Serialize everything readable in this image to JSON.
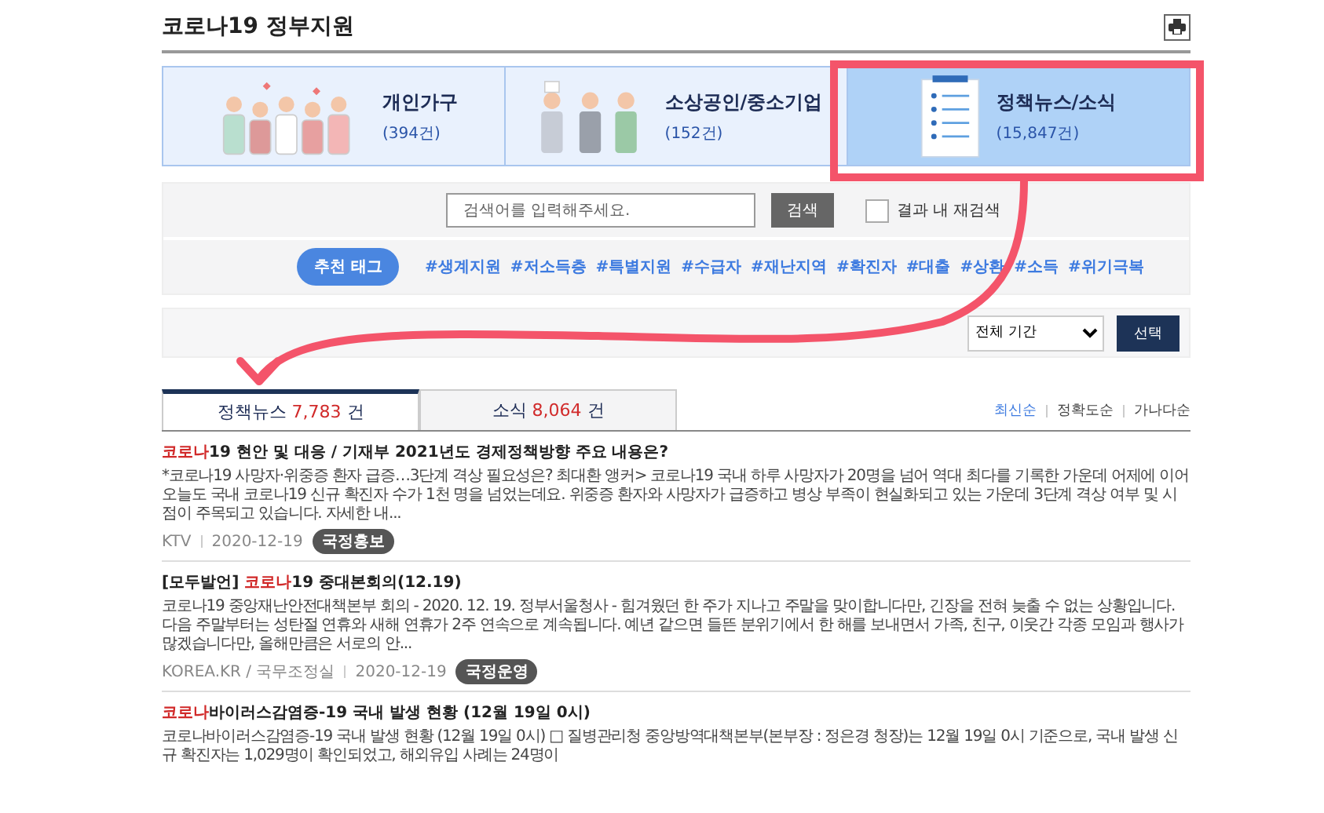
{
  "page_title": "코로나19 정부지원",
  "categories": [
    {
      "kind": "people",
      "label": "개인가구",
      "count": "(394건)",
      "selected": false
    },
    {
      "kind": "workers",
      "label": "소상공인/중소기업",
      "count": "(152건)",
      "selected": false
    },
    {
      "kind": "clipboard",
      "label": "정책뉴스/소식",
      "count": "(15,847건)",
      "selected": true
    }
  ],
  "search": {
    "placeholder": "검색어를 입력해주세요.",
    "button": "검색",
    "refine_label": "결과 내 재검색",
    "refine_checked": false
  },
  "tags": {
    "label": "추천 태그",
    "items": [
      "#생계지원",
      "#저소득층",
      "#특별지원",
      "#수급자",
      "#재난지역",
      "#확진자",
      "#대출",
      "#상환",
      "#소득",
      "#위기극복"
    ]
  },
  "filter": {
    "period": "전체 기간",
    "button": "선택"
  },
  "tabs": [
    {
      "label": "정책뉴스",
      "count": "7,783",
      "unit": "건",
      "selected": true
    },
    {
      "label": "소식",
      "count": "8,064",
      "unit": "건",
      "selected": false
    }
  ],
  "sort": [
    {
      "label": "최신순",
      "selected": true
    },
    {
      "label": "정확도순",
      "selected": false
    },
    {
      "label": "가나다순",
      "selected": false
    }
  ],
  "articles": [
    {
      "title": [
        {
          "kind": "highlight",
          "text": "코로나"
        },
        {
          "kind": "plain",
          "text": "19 현안 및 대응 / 기재부 2021년도 경제정책방향 주요 내용은?"
        }
      ],
      "body": "*코로나19 사망자·위중증 환자 급증…3단계 격상 필요성은? 최대환 앵커> 코로나19 국내 하루 사망자가 20명을 넘어 역대 최다를 기록한 가운데 어제에 이어 오늘도 국내 코로나19 신규 확진자 수가 1천 명을 넘었는데요. 위중증 환자와 사망자가 급증하고 병상 부족이 현실화되고 있는 가운데 3단계 격상 여부 및 시점이 주목되고 있습니다. 자세한 내...",
      "source": "KTV",
      "date": "2020-12-19",
      "badge": "국정홍보"
    },
    {
      "title": [
        {
          "kind": "plain",
          "text": "[모두발언] "
        },
        {
          "kind": "highlight",
          "text": "코로나"
        },
        {
          "kind": "plain",
          "text": "19 중대본회의(12.19)"
        }
      ],
      "body": "코로나19 중앙재난안전대책본부 회의 - 2020. 12. 19. 정부서울청사 - 힘겨웠던 한 주가 지나고 주말을 맞이합니다만, 긴장을 전혀 늦출 수 없는 상황입니다. 다음 주말부터는 성탄절 연휴와 새해 연휴가 2주 연속으로 계속됩니다. 예년 같으면 들뜬 분위기에서 한 해를 보내면서 가족, 친구, 이웃간 각종 모임과 행사가 많겠습니다만, 올해만큼은 서로의 안...",
      "source": "KOREA.KR / 국무조정실",
      "date": "2020-12-19",
      "badge": "국정운영"
    },
    {
      "title": [
        {
          "kind": "highlight",
          "text": "코로나"
        },
        {
          "kind": "plain",
          "text": "바이러스감염증-19 국내 발생 현황 (12월 19일 0시)"
        }
      ],
      "body": "코로나바이러스감염증-19 국내 발생 현황 (12월 19일 0시) □ 질병관리청 중앙방역대책본부(본부장 : 정은경 청장)는 12월 19일 0시 기준으로, 국내 발생 신규 확진자는 1,029명이 확인되었고, 해외유입 사례는 24명이"
    }
  ]
}
